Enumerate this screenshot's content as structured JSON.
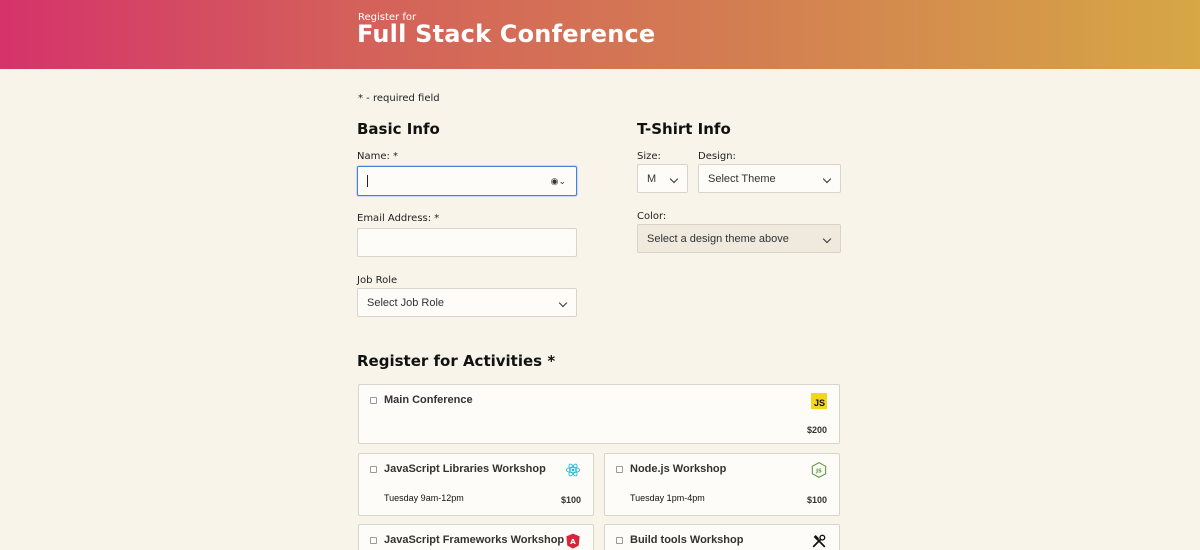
{
  "header": {
    "subtitle": "Register for",
    "title": "Full Stack Conference"
  },
  "required_note": "* - required field",
  "basic_info": {
    "heading": "Basic Info",
    "name_label": "Name: *",
    "name_value": "",
    "email_label": "Email Address: *",
    "email_value": "",
    "job_role_label": "Job Role",
    "job_role_selected": "Select Job Role"
  },
  "tshirt": {
    "heading": "T-Shirt Info",
    "size_label": "Size:",
    "size_selected": "M",
    "design_label": "Design:",
    "design_selected": "Select Theme",
    "color_label": "Color:",
    "color_selected": "Select a design theme above"
  },
  "activities": {
    "heading": "Register for Activities *",
    "items": [
      {
        "name": "Main Conference",
        "time": "",
        "price": "$200",
        "icon": "javascript-icon"
      },
      {
        "name": "JavaScript Libraries Workshop",
        "time": "Tuesday 9am-12pm",
        "price": "$100",
        "icon": "react-icon"
      },
      {
        "name": "Node.js Workshop",
        "time": "Tuesday 1pm-4pm",
        "price": "$100",
        "icon": "nodejs-icon"
      },
      {
        "name": "JavaScript Frameworks Workshop",
        "time": "",
        "price": "",
        "icon": "angular-icon"
      },
      {
        "name": "Build tools Workshop",
        "time": "",
        "price": "",
        "icon": "tools-icon"
      }
    ]
  },
  "colors": {
    "gradient_start": "#d5336a",
    "gradient_end": "#d6a745",
    "page_background": "#f8f4ea",
    "focus_border": "#4b7fd8"
  }
}
